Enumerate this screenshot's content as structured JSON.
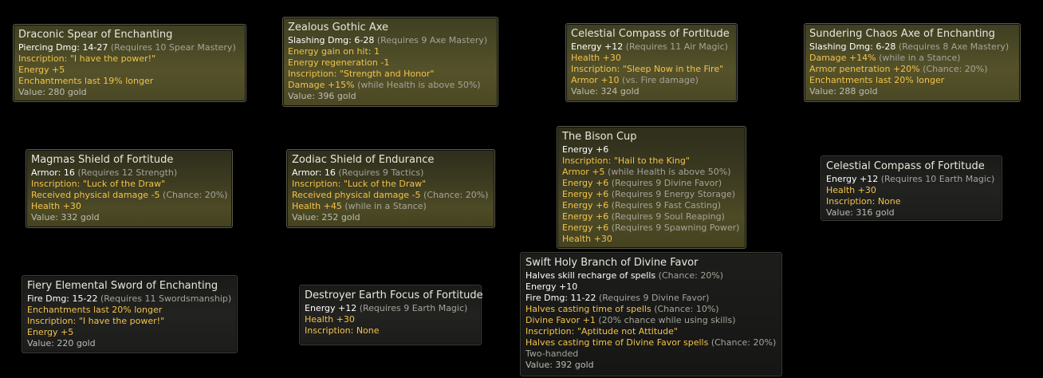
{
  "items": [
    {
      "id": "draconic-spear",
      "title": "Draconic Spear of Enchanting",
      "lines": [
        [
          {
            "t": "Piercing Dmg: 14-27 ",
            "c": "w"
          },
          {
            "t": "(Requires 10 Spear Mastery)",
            "c": "g"
          }
        ],
        [
          {
            "t": "Inscription: \"I have the power!\"",
            "c": "y"
          }
        ],
        [
          {
            "t": "Energy +5",
            "c": "y"
          }
        ],
        [
          {
            "t": "Enchantments last 19% longer",
            "c": "y"
          }
        ],
        [
          {
            "t": "Value: 280 gold",
            "c": "v"
          }
        ]
      ]
    },
    {
      "id": "zealous-gothic-axe",
      "title": "Zealous Gothic Axe",
      "lines": [
        [
          {
            "t": "Slashing Dmg: 6-28 ",
            "c": "w"
          },
          {
            "t": "(Requires 9 Axe Mastery)",
            "c": "g"
          }
        ],
        [
          {
            "t": "Energy gain on hit: 1",
            "c": "y"
          }
        ],
        [
          {
            "t": "Energy regeneration -1",
            "c": "y"
          }
        ],
        [
          {
            "t": "Inscription: \"Strength and Honor\"",
            "c": "y"
          }
        ],
        [
          {
            "t": "Damage +15% ",
            "c": "y"
          },
          {
            "t": "(while Health is above 50%)",
            "c": "g"
          }
        ],
        [
          {
            "t": "Value: 396 gold",
            "c": "v"
          }
        ]
      ]
    },
    {
      "id": "celestial-compass-1",
      "title": "Celestial Compass of Fortitude",
      "lines": [
        [
          {
            "t": "Energy +12 ",
            "c": "w"
          },
          {
            "t": "(Requires 11 Air Magic)",
            "c": "g"
          }
        ],
        [
          {
            "t": "Health +30",
            "c": "y"
          }
        ],
        [
          {
            "t": "Inscription: \"Sleep Now in the Fire\"",
            "c": "y"
          }
        ],
        [
          {
            "t": "Armor +10 ",
            "c": "y"
          },
          {
            "t": "(vs. Fire damage)",
            "c": "g"
          }
        ],
        [
          {
            "t": "Value: 324 gold",
            "c": "v"
          }
        ]
      ]
    },
    {
      "id": "sundering-chaos-axe",
      "title": "Sundering Chaos Axe of Enchanting",
      "lines": [
        [
          {
            "t": "Slashing Dmg: 6-28 ",
            "c": "w"
          },
          {
            "t": "(Requires 8 Axe Mastery)",
            "c": "g"
          }
        ],
        [
          {
            "t": "Damage +14% ",
            "c": "y"
          },
          {
            "t": "(while in a Stance)",
            "c": "g"
          }
        ],
        [
          {
            "t": "Armor penetration +20% ",
            "c": "y"
          },
          {
            "t": "(Chance: 20%)",
            "c": "g"
          }
        ],
        [
          {
            "t": "Enchantments last 20% longer",
            "c": "y"
          }
        ],
        [
          {
            "t": "Value: 288 gold",
            "c": "v"
          }
        ]
      ]
    },
    {
      "id": "magmas-shield",
      "title": "Magmas Shield of Fortitude",
      "lines": [
        [
          {
            "t": "Armor: 16 ",
            "c": "w"
          },
          {
            "t": "(Requires 12 Strength)",
            "c": "g"
          }
        ],
        [
          {
            "t": "Inscription: \"Luck of the Draw\"",
            "c": "y"
          }
        ],
        [
          {
            "t": "Received physical damage -5 ",
            "c": "y"
          },
          {
            "t": "(Chance: 20%)",
            "c": "g"
          }
        ],
        [
          {
            "t": "Health +30",
            "c": "y"
          }
        ],
        [
          {
            "t": "Value: 332 gold",
            "c": "v"
          }
        ]
      ]
    },
    {
      "id": "zodiac-shield",
      "title": "Zodiac Shield of Endurance",
      "lines": [
        [
          {
            "t": "Armor: 16 ",
            "c": "w"
          },
          {
            "t": "(Requires 9 Tactics)",
            "c": "g"
          }
        ],
        [
          {
            "t": "Inscription: \"Luck of the Draw\"",
            "c": "y"
          }
        ],
        [
          {
            "t": "Received physical damage -5 ",
            "c": "y"
          },
          {
            "t": "(Chance: 20%)",
            "c": "g"
          }
        ],
        [
          {
            "t": "Health +45 ",
            "c": "y"
          },
          {
            "t": "(while in a Stance)",
            "c": "g"
          }
        ],
        [
          {
            "t": "Value: 252 gold",
            "c": "v"
          }
        ]
      ]
    },
    {
      "id": "bison-cup",
      "title": "The Bison Cup",
      "lines": [
        [
          {
            "t": "Energy +6",
            "c": "w"
          }
        ],
        [
          {
            "t": "Inscription: \"Hail to the King\"",
            "c": "y"
          }
        ],
        [
          {
            "t": "Armor +5 ",
            "c": "y"
          },
          {
            "t": "(while Health is above 50%)",
            "c": "g"
          }
        ],
        [
          {
            "t": "Energy +6 ",
            "c": "y"
          },
          {
            "t": "(Requires 9 Divine Favor)",
            "c": "g"
          }
        ],
        [
          {
            "t": "Energy +6 ",
            "c": "y"
          },
          {
            "t": "(Requires 9 Energy Storage)",
            "c": "g"
          }
        ],
        [
          {
            "t": "Energy +6 ",
            "c": "y"
          },
          {
            "t": "(Requires 9 Fast Casting)",
            "c": "g"
          }
        ],
        [
          {
            "t": "Energy +6 ",
            "c": "y"
          },
          {
            "t": "(Requires 9 Soul Reaping)",
            "c": "g"
          }
        ],
        [
          {
            "t": "Energy +6 ",
            "c": "y"
          },
          {
            "t": "(Requires 9 Spawning Power)",
            "c": "g"
          }
        ],
        [
          {
            "t": "Health +30",
            "c": "y"
          }
        ]
      ]
    },
    {
      "id": "celestial-compass-2",
      "title": "Celestial Compass of Fortitude",
      "lines": [
        [
          {
            "t": "Energy +12 ",
            "c": "w"
          },
          {
            "t": "(Requires 10 Earth Magic)",
            "c": "g"
          }
        ],
        [
          {
            "t": "Health +30",
            "c": "y"
          }
        ],
        [
          {
            "t": "Inscription: None",
            "c": "y"
          }
        ],
        [
          {
            "t": "Value: 316 gold",
            "c": "v"
          }
        ]
      ]
    },
    {
      "id": "fiery-elemental-sword",
      "title": "Fiery Elemental Sword of Enchanting",
      "lines": [
        [
          {
            "t": "Fire Dmg: 15-22 ",
            "c": "w"
          },
          {
            "t": "(Requires 11 Swordsmanship)",
            "c": "g"
          }
        ],
        [
          {
            "t": "Enchantments last 20% longer",
            "c": "y"
          }
        ],
        [
          {
            "t": "Inscription: \"I have the power!\"",
            "c": "y"
          }
        ],
        [
          {
            "t": "Energy +5",
            "c": "y"
          }
        ],
        [
          {
            "t": "Value: 220 gold",
            "c": "v"
          }
        ]
      ]
    },
    {
      "id": "destroyer-earth-focus",
      "title": "Destroyer Earth Focus of Fortitude",
      "lines": [
        [
          {
            "t": "Energy +12 ",
            "c": "w"
          },
          {
            "t": "(Requires 9 Earth Magic)",
            "c": "g"
          }
        ],
        [
          {
            "t": "Health +30",
            "c": "y"
          }
        ],
        [
          {
            "t": "Inscription: None",
            "c": "y"
          }
        ]
      ]
    },
    {
      "id": "swift-holy-branch",
      "title": "Swift Holy Branch of Divine Favor",
      "lines": [
        [
          {
            "t": "Halves skill recharge of spells ",
            "c": "w"
          },
          {
            "t": "(Chance: 20%)",
            "c": "g"
          }
        ],
        [
          {
            "t": "Energy +10",
            "c": "w"
          }
        ],
        [
          {
            "t": "Fire Dmg: 11-22 ",
            "c": "w"
          },
          {
            "t": "(Requires 9 Divine Favor)",
            "c": "g"
          }
        ],
        [
          {
            "t": "Halves casting time of spells ",
            "c": "y"
          },
          {
            "t": "(Chance: 10%)",
            "c": "g"
          }
        ],
        [
          {
            "t": "Divine Favor +1 ",
            "c": "y"
          },
          {
            "t": "(20% chance while using skills)",
            "c": "g"
          }
        ],
        [
          {
            "t": "Inscription: \"Aptitude not Attitude\"",
            "c": "y"
          }
        ],
        [
          {
            "t": "Halves casting time of Divine Favor spells ",
            "c": "y"
          },
          {
            "t": "(Chance: 20%)",
            "c": "g"
          }
        ],
        [
          {
            "t": "Two-handed",
            "c": "g"
          }
        ],
        [
          {
            "t": "Value: 392 gold",
            "c": "v"
          }
        ]
      ]
    }
  ]
}
